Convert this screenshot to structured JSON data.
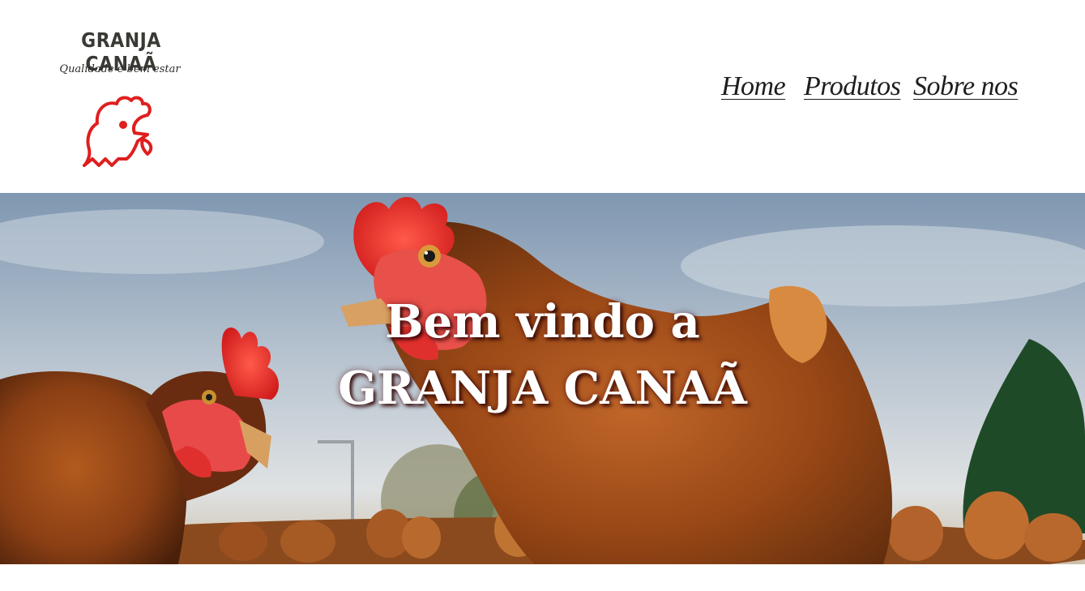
{
  "brand": {
    "name": "GRANJA CANAÃ",
    "tagline": "Qualidade e bem estar",
    "icon": "rooster-icon",
    "accent_color": "#e01e1e"
  },
  "nav": {
    "items": [
      {
        "label": "Home"
      },
      {
        "label": "Produtos"
      },
      {
        "label": "Sobre nos"
      }
    ]
  },
  "hero": {
    "title_line1": "Bem vindo a",
    "title_line2": "GRANJA CANAÃ",
    "image": "chickens-photo"
  }
}
